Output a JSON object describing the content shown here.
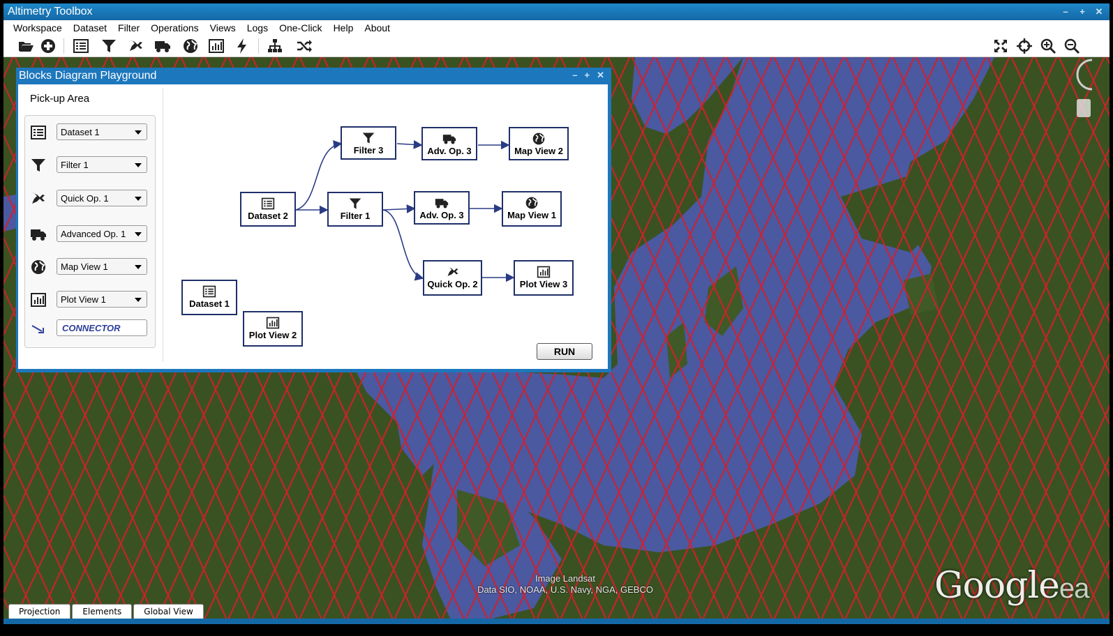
{
  "app": {
    "title": "Altimetry Toolbox"
  },
  "menu": [
    "Workspace",
    "Dataset",
    "Filter",
    "Operations",
    "Views",
    "Logs",
    "One-Click",
    "Help",
    "About"
  ],
  "toolbar": {
    "left": [
      "open-folder-icon",
      "add-circle-icon",
      "dataset-list-icon",
      "filter-icon",
      "quick-op-icon",
      "advanced-op-icon",
      "globe-icon",
      "chart-icon",
      "bolt-icon",
      "hierarchy-icon",
      "shuffle-icon"
    ],
    "right": [
      "fullscreen-icon",
      "crosshair-icon",
      "zoom-in-icon",
      "zoom-out-icon"
    ]
  },
  "dialog": {
    "title": "Blocks Diagram Playground",
    "pick_area_title": "Pick-up Area",
    "pick_items": [
      {
        "icon": "dataset-list-icon",
        "value": "Dataset 1"
      },
      {
        "icon": "filter-icon",
        "value": "Filter 1"
      },
      {
        "icon": "quick-op-icon",
        "value": "Quick Op. 1"
      },
      {
        "icon": "advanced-op-icon",
        "value": "Advanced Op. 1"
      },
      {
        "icon": "globe-icon",
        "value": "Map View 1"
      },
      {
        "icon": "chart-icon",
        "value": "Plot View 1"
      }
    ],
    "connector_label": "CONNECTOR",
    "blocks": [
      {
        "icon": "filter-icon",
        "label": "Filter 3"
      },
      {
        "icon": "advanced-op-icon",
        "label": "Adv. Op. 3"
      },
      {
        "icon": "globe-icon",
        "label": "Map View 2"
      },
      {
        "icon": "dataset-list-icon",
        "label": "Dataset 2"
      },
      {
        "icon": "filter-icon",
        "label": "Filter 1"
      },
      {
        "icon": "advanced-op-icon",
        "label": "Adv. Op. 3"
      },
      {
        "icon": "globe-icon",
        "label": "Map View 1"
      },
      {
        "icon": "quick-op-icon",
        "label": "Quick Op. 2"
      },
      {
        "icon": "chart-icon",
        "label": "Plot View 3"
      },
      {
        "icon": "dataset-list-icon",
        "label": "Dataset 1"
      },
      {
        "icon": "chart-icon",
        "label": "Plot View 2"
      }
    ],
    "run_label": "RUN"
  },
  "map": {
    "attribution_line1": "Image Landsat",
    "attribution_line2": "Data SIO, NOAA, U.S. Navy, NGA, GEBCO",
    "logo_text": "Google",
    "logo_suffix": "ea"
  },
  "bottom_tabs": [
    "Projection",
    "Elements",
    "Global View"
  ]
}
